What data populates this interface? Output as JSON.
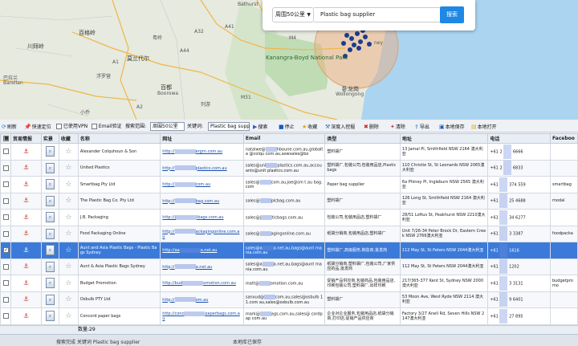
{
  "map": {
    "labels": {
      "bathurst": "Bathurst",
      "city_shanghai": "上海",
      "a32": "A32",
      "a41": "A41",
      "a44": "A44",
      "m4": "M4",
      "m31": "M31",
      "a1": "A1",
      "a2": "A2",
      "baigeling": "百格岭",
      "chuanbailing": "川拜岭",
      "kanangra": "Kanangra-Boyd National Park",
      "yueling": "粤岭",
      "morundale": "莫兰代尔",
      "baidu": "百都",
      "boorowa": "Boorowa",
      "wollongong_cn": "卧龙岗",
      "wollongong": "Wollongong",
      "balaran": "巴拉兰",
      "barellan": "Barellan",
      "fuluoying": "浮罗营",
      "xiaoqiao": "小乔",
      "lieyou": "列游",
      "ney": "ney"
    },
    "search": {
      "radius": "周围50公里",
      "keyword": "Plastic bag supplier",
      "button": "搜索"
    }
  },
  "toolbar": {
    "refresh": "刷新",
    "fast_locate": "快速定位",
    "vpn": "已使用VPN",
    "email_verify": "Email验证",
    "search_range": "搜索范围:",
    "range_value": "周围50公里",
    "keyword_label": "关键词:",
    "keyword_value": "Plastic bag supp",
    "search": "搜索",
    "stop": "停止",
    "favorite": "收藏",
    "dig": "深度入挖掘",
    "delete": "删除",
    "clear": "清除",
    "export": "导出",
    "save": "本地保存",
    "open": "本地打开"
  },
  "grid": {
    "headers": [
      "贸易情报",
      "实景",
      "收藏",
      "名称",
      "网址",
      "Email",
      "类型",
      "地址",
      "电话",
      "Faceboo"
    ],
    "rows": [
      {
        "name": "Alexander Colquhoun & Son",
        "url_a": "http://",
        "url_b": "ergrn.com.au",
        "email_a": "natalwe@",
        "email_b": "@colqu",
        "email_c": "hboune.com.au,globalta",
        "email_d": "com.au,aswsales@bo",
        "type": "塑料袋厂",
        "address": "13 Jamal Pl, Smithfield NSW 2164 澳大利亚",
        "tel_a": "+61 2",
        "tel_b": "6666",
        "fb": ""
      },
      {
        "name": "United Plastics",
        "url_a": "http://",
        "url_b": "plastics.com.au",
        "email_a": "sales@uni",
        "email_b": "ants@unit",
        "email_c": "plastics.com.au,accou",
        "email_d": "plastics.com.au",
        "type": "塑料袋厂,包装公司,包装用品店,Plastic bags",
        "address": "110 Christie St, St Leonards NSW 2065澳大利亚",
        "tel_a": "+61 2",
        "tel_b": "6833",
        "fb": ""
      },
      {
        "name": "Smartbag Pty Ltd",
        "url_a": "http://",
        "url_b": "com.au",
        "email_a": "sales@",
        "email_b": "t.au",
        "email_c": "com.au,joe@sm",
        "email_d": "bag.com",
        "type": "Paper bag supplier",
        "address": "6a Phiney Pl, Ingleburn NSW 2565 澳大利亚",
        "tel_a": "+61",
        "tel_b": "374 559",
        "fb": "smartbag"
      },
      {
        "name": "The Plastic Bag Co. Pty Ltd",
        "url_a": "http://",
        "url_b": "bag.com.au",
        "email_a": "sales@",
        "email_b": "",
        "email_c": "plcbag.com.au",
        "email_d": "",
        "type": "塑料袋厂",
        "address": "126 Long St, Smithfield NSW 2164 澳大利亚",
        "tel_a": "+61",
        "tel_b": "25 4688",
        "fb": "modal"
      },
      {
        "name": "J.B. Packaging",
        "url_a": "http://j",
        "url_b": "ibags.com.au",
        "email_a": "sales@j",
        "email_b": "",
        "email_c": "ticbags.com.au",
        "email_d": "",
        "type": "包装公司,包装用品店,塑料袋厂",
        "address": "28/51 Loftus St, Peakhurst NSW 2210澳大利亚",
        "tel_a": "+61",
        "tel_b": "34 6277",
        "fb": ""
      },
      {
        "name": "Food Packaging Online",
        "url_a": "http://",
        "url_b": "ackagingonline.com.au",
        "email_a": "sales@",
        "email_b": "",
        "email_c": "agingonline.com.au",
        "email_d": "",
        "type": "纸袋分销商,包装用品店,塑料袋厂",
        "address": "Unit 7/26-34 Peter Brock Dr, Eastern Creek NSW 2766澳大利亚",
        "tel_a": "+61",
        "tel_b": "3 3387",
        "fb": "foodpacka"
      },
      {
        "name": "Aunt and Asia Plastic Bags - Plastic Bags Sydney",
        "url_a": "http://aa",
        "url_b": "a.net.au",
        "email_a": "sales@a",
        "email_b": "",
        "email_c": "a.net.au,bags@aunt",
        "email_d": "mania.com.au",
        "type": "塑料袋厂,高级服务,制造商,批发商",
        "address": "112 May St, St Peters NSW 2044澳大利亚",
        "tel_a": "+61",
        "tel_b": "1616",
        "fb": ""
      },
      {
        "name": "Aunt & Asia Plastic Bags Sydney",
        "url_a": "http://",
        "url_b": "a.net.au",
        "email_a": "sales@a",
        "email_b": "",
        "email_c": "a.net.au,bags@aunt",
        "email_d": "mania.com.au",
        "type": "纸袋分销商,塑料袋厂,包装公司,厂家供应的品,批发商",
        "address": "112 May St, St Peters NSW 2044澳大利亚",
        "tel_a": "+61",
        "tel_b": "1202",
        "fb": ""
      },
      {
        "name": "Budget Promotion",
        "url_a": "http://bud",
        "url_b": "omotion.com.au",
        "email_a": "matt@",
        "email_b": "",
        "email_c": "omotion.com.au",
        "email_d": "",
        "type": "促销产品供应商,包装商品,包装用品店,印刷包装公司,塑料袋厂,出样印刷",
        "address": "217/365-377 Kent St, Sydney NSW 2000澳大利亚",
        "tel_a": "+61",
        "tel_b": "3 3131",
        "fb": "budgetpromo"
      },
      {
        "name": "Osbulb PTY Ltd",
        "url_a": "http://",
        "url_b": "om.au",
        "email_a": "sanxud@",
        "email_b": "11.com",
        "email_c": "com.au,sales@osbulb",
        "email_d": "au,sales@osbulb.com.au",
        "type": "塑料袋厂",
        "address": "53 Moon Ave, West Ryde NSW 2114 澳大利亚",
        "tel_a": "+61",
        "tel_b": "9 6401",
        "fb": ""
      },
      {
        "name": "Concord paper bags",
        "url_a": "http://conc",
        "url_b": "paperbags.com.au",
        "email_a": "mark@",
        "email_b": "cordpap",
        "email_c": "ags.com.au,sales@",
        "email_d": "com.au",
        "type": "企业对企业服务,包装用品店,纸袋分销商,打印店,促销产品供应商",
        "address": "Factory 3/27 Anell Rd, Seven Hills NSW 2147澳大利亚",
        "tel_a": "+61",
        "tel_b": "27 895",
        "fb": ""
      }
    ],
    "selected_row": 6,
    "count_label": "数量:29"
  },
  "status": {
    "left": "搜索完成 关键词 Plastic bag supplier",
    "right": "本地库已保存"
  }
}
